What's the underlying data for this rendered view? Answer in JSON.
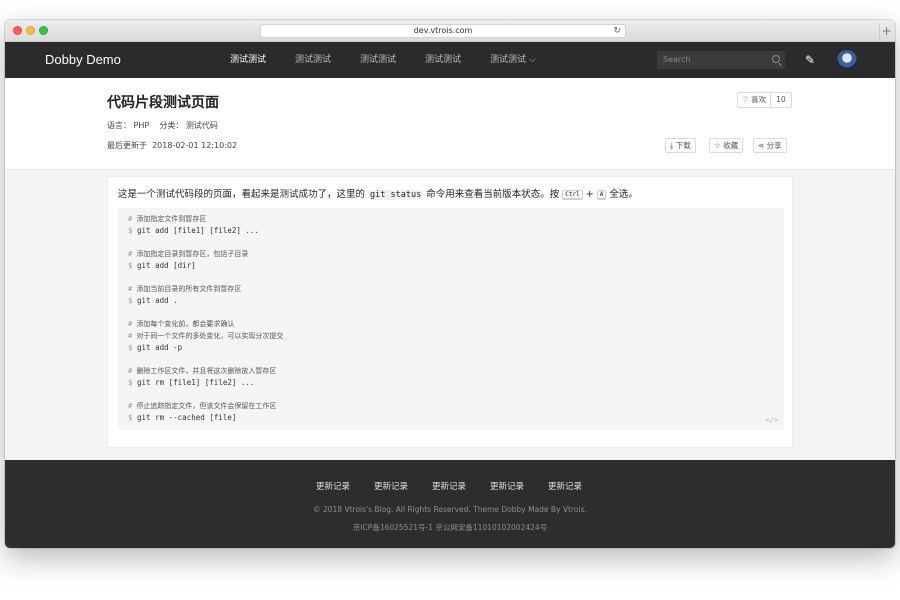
{
  "browser": {
    "url": "dev.vtrois.com",
    "reload_icon": "reload-icon",
    "newtab_label": "+"
  },
  "nav": {
    "brand": "Dobby Demo",
    "items": [
      {
        "label": "测试测试",
        "active": true
      },
      {
        "label": "测试测试"
      },
      {
        "label": "测试测试"
      },
      {
        "label": "测试测试"
      },
      {
        "label": "测试测试 ⌵"
      }
    ],
    "search_placeholder": "Search",
    "pencil_icon": "✎"
  },
  "header": {
    "title": "代码片段测试页面",
    "language_line": "语言： PHP    分类： 测试代码",
    "updated": "最后更新于  2018-02-01 12:10:02",
    "like_label": "♡ 喜欢",
    "like_count": "10",
    "download_label": "⤓ 下载",
    "collect_label": "☆ 收藏",
    "share_label": "⋖ 分享"
  },
  "article": {
    "intro_before": "这是一个测试代码段的页面，看起来是测试成功了，这里的 ",
    "intro_code": "git status",
    "intro_mid": " 命令用来查看当前版本状态。按 ",
    "key1": "Ctrl",
    "plus": " + ",
    "key2": "A",
    "intro_after": " 全选。",
    "code_lines": [
      {
        "prefix": "# ",
        "text": "添加指定文件到暂存区",
        "comment": true
      },
      {
        "prefix": "$ ",
        "text": "git add [file1] [file2] ...",
        "comment": false
      },
      {
        "prefix": "# ",
        "text": "添加指定目录到暂存区，包括子目录",
        "comment": true
      },
      {
        "prefix": "$ ",
        "text": "git add [dir]",
        "comment": false
      },
      {
        "prefix": "# ",
        "text": "添加当前目录的所有文件到暂存区",
        "comment": true
      },
      {
        "prefix": "$ ",
        "text": "git add .",
        "comment": false
      },
      {
        "prefix": "# ",
        "text": "添加每个变化前，都会要求确认",
        "comment": true
      },
      {
        "prefix": "# ",
        "text": "对于同一个文件的多处变化，可以实现分次提交",
        "comment": true
      },
      {
        "prefix": "$ ",
        "text": "git add -p",
        "comment": false
      },
      {
        "prefix": "# ",
        "text": "删除工作区文件，并且将这次删除放入暂存区",
        "comment": true
      },
      {
        "prefix": "$ ",
        "text": "git rm [file1] [file2] ...",
        "comment": false
      },
      {
        "prefix": "# ",
        "text": "停止追踪指定文件，但该文件会保留在工作区",
        "comment": true
      },
      {
        "prefix": "$ ",
        "text": "git rm --cached [file]",
        "comment": false
      }
    ],
    "code_icon": "</>"
  },
  "footer": {
    "links": [
      "更新记录",
      "更新记录",
      "更新记录",
      "更新记录",
      "更新记录"
    ],
    "copyright": "© 2018 Vtrois's Blog. All Rights Reserved. Theme Dobby Made By Vtrois.",
    "icp": "京ICP备16025521号-1 京公网安备11010102002424号"
  }
}
